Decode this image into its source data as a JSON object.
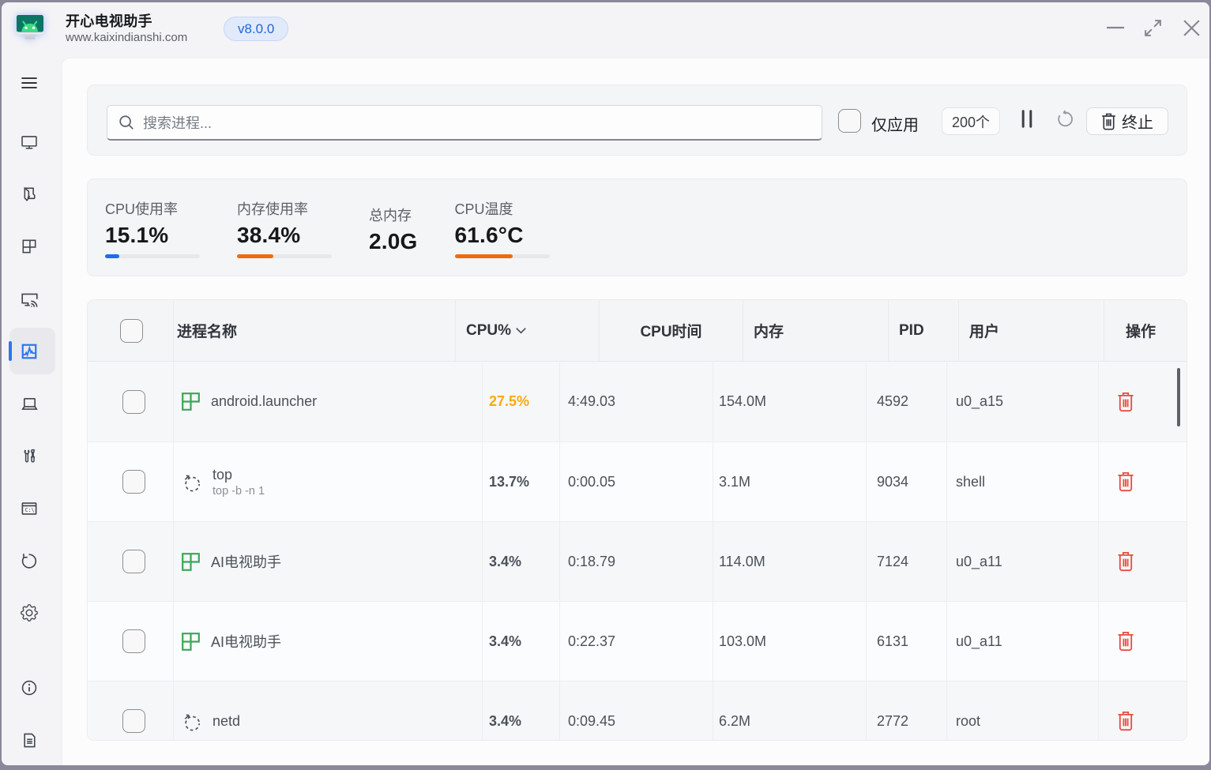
{
  "titlebar": {
    "app_title": "开心电视助手",
    "app_subtitle": "www.kaixindianshi.com",
    "version_badge": "v8.0.0"
  },
  "sidebar": {
    "active_item": "process-monitor",
    "items": [
      {
        "id": "menu",
        "icon": "menu-icon"
      },
      {
        "id": "device-screen",
        "icon": "desktop-icon"
      },
      {
        "id": "app-install",
        "icon": "package-icon"
      },
      {
        "id": "app-manage",
        "icon": "grid-icon"
      },
      {
        "id": "screen-cast",
        "icon": "screen-cast-icon"
      },
      {
        "id": "process-monitor",
        "icon": "activity-monitor-icon"
      },
      {
        "id": "remote-device",
        "icon": "laptop-icon"
      },
      {
        "id": "toolbox",
        "icon": "tools-icon"
      },
      {
        "id": "terminal",
        "icon": "terminal-icon"
      },
      {
        "id": "reboot",
        "icon": "rotate-ccw-icon"
      },
      {
        "id": "settings",
        "icon": "gear-icon"
      },
      {
        "id": "about",
        "icon": "info-icon"
      },
      {
        "id": "logs",
        "icon": "document-icon"
      }
    ]
  },
  "toolbar": {
    "search_placeholder": "搜索进程...",
    "apps_only_label": "仅应用",
    "apps_only_checked": false,
    "process_count": "200个",
    "pause_icon": "pause-icon",
    "refresh_icon": "refresh-icon",
    "terminate_label": "终止"
  },
  "stats": {
    "cpu_usage": {
      "label": "CPU使用率",
      "value": "15.1%",
      "percent": 15.1
    },
    "memory_usage": {
      "label": "内存使用率",
      "value": "38.4%",
      "percent": 38.4
    },
    "total_memory": {
      "label": "总内存",
      "value": "2.0G"
    },
    "cpu_temp": {
      "label": "CPU温度",
      "value": "61.6°C",
      "percent": 61.6
    }
  },
  "table": {
    "columns": [
      "进程名称",
      "CPU%",
      "CPU时间",
      "内存",
      "PID",
      "用户",
      "操作"
    ],
    "sort_column": "CPU%",
    "sort_direction": "desc",
    "rows": [
      {
        "name": "android.launcher",
        "icon": "app-grid-icon",
        "cpu": "27.5%",
        "time": "4:49.03",
        "mem": "154.0M",
        "pid": "4592",
        "user": "u0_a15"
      },
      {
        "name": "top",
        "command": "top -b -n 1",
        "icon": "process-icon",
        "cpu": "13.7%",
        "time": "0:00.05",
        "mem": "3.1M",
        "pid": "9034",
        "user": "shell"
      },
      {
        "name": "AI电视助手",
        "icon": "app-grid-icon",
        "cpu": "3.4%",
        "time": "0:18.79",
        "mem": "114.0M",
        "pid": "7124",
        "user": "u0_a11"
      },
      {
        "name": "AI电视助手",
        "icon": "app-grid-icon",
        "cpu": "3.4%",
        "time": "0:22.37",
        "mem": "103.0M",
        "pid": "6131",
        "user": "u0_a11"
      },
      {
        "name": "netd",
        "icon": "process-icon",
        "cpu": "3.4%",
        "time": "0:09.45",
        "mem": "6.2M",
        "pid": "2772",
        "user": "root"
      }
    ]
  },
  "colors": {
    "accent_blue": "#2b77ee",
    "progress_blue": "#1f6bf2",
    "orange": "#ee6c0c",
    "amber_cpu_highlight": "#f7ab0a",
    "danger_red": "#e84b40",
    "app_green": "#3aa757",
    "window_border": "#8a8899"
  }
}
